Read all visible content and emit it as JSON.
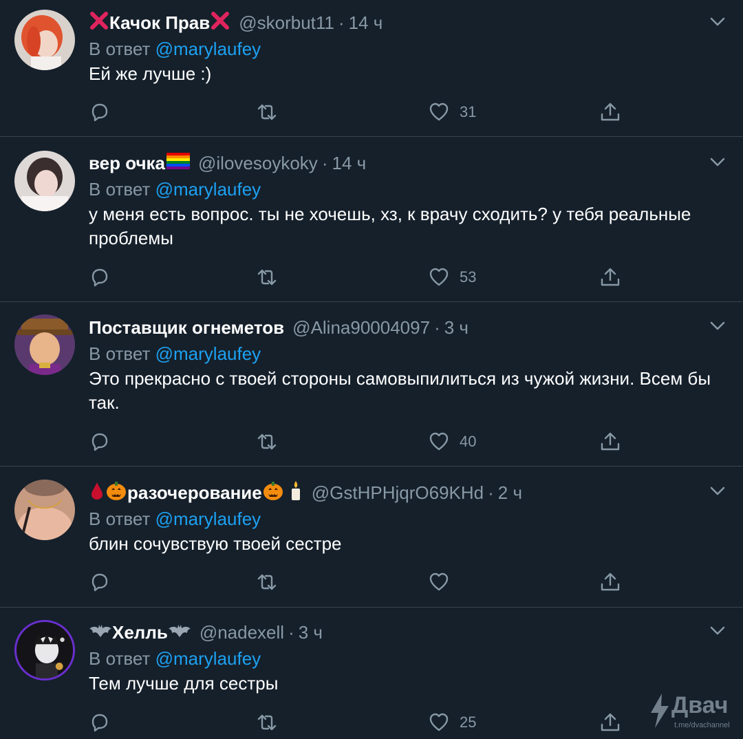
{
  "tweets": [
    {
      "display_name": "Качок Прав",
      "name_prefix": "❌",
      "name_suffix": "❌",
      "handle": "@skorbut11",
      "separator": "·",
      "time": "14 ч",
      "reply_prefix": "В ответ",
      "reply_to": "@marylaufey",
      "text": "Ей же лучше :)",
      "likes": "31"
    },
    {
      "display_name": "вер очка",
      "name_prefix": "",
      "name_suffix": "🏳️‍🌈",
      "handle": "@ilovesoykoky",
      "separator": "·",
      "time": "14 ч",
      "reply_prefix": "В ответ",
      "reply_to": "@marylaufey",
      "text": "у меня есть вопрос. ты не хочешь, хз, к врачу сходить?  у тебя реальные проблемы",
      "likes": "53"
    },
    {
      "display_name": "Поставщик огнеметов",
      "name_prefix": "",
      "name_suffix": "",
      "handle": "@Alina90004097",
      "separator": "·",
      "time": "3 ч",
      "reply_prefix": "В ответ",
      "reply_to": "@marylaufey",
      "text": "Это прекрасно с твоей стороны самовыпилиться из чужой жизни. Всем бы так.",
      "likes": "40"
    },
    {
      "display_name": "разочерование",
      "name_prefix": "🩸🎃",
      "name_suffix": "🎃🕯️",
      "handle": "@GstHPHjqrO69KHd",
      "separator": "·",
      "time": "2 ч",
      "reply_prefix": "В ответ",
      "reply_to": "@marylaufey",
      "text": "блин сочувствую твоей сестре",
      "likes": ""
    },
    {
      "display_name": "Хелль",
      "name_prefix": "🦇",
      "name_suffix": "🦇",
      "handle": "@nadexell",
      "separator": "·",
      "time": "3 ч",
      "reply_prefix": "В ответ",
      "reply_to": "@marylaufey",
      "text": "Тем лучше для сестры",
      "likes": "25"
    }
  ],
  "watermark": {
    "title": "Двач",
    "subtitle": "t.me/dvachannel"
  },
  "colors": {
    "background": "#15202b",
    "divider": "#38444d",
    "secondary_text": "#8899a6",
    "mention": "#1da1f2",
    "primary_text": "#ffffff"
  },
  "icons": [
    "chevron-down-icon",
    "reply-icon",
    "retweet-icon",
    "like-icon",
    "share-icon",
    "lightning-icon"
  ]
}
